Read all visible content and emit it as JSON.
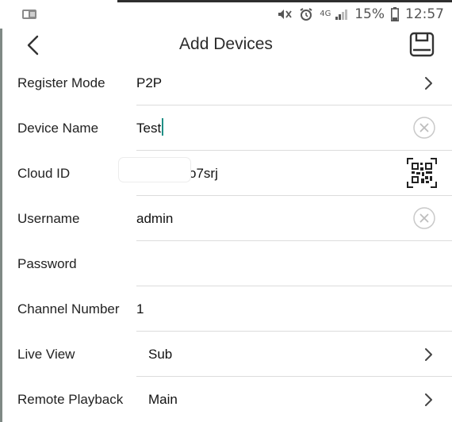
{
  "status_bar": {
    "battery": "15%",
    "time": "12:57",
    "network": "4G"
  },
  "header": {
    "title": "Add Devices"
  },
  "form": {
    "register_mode": {
      "label": "Register Mode",
      "value": "P2P"
    },
    "device_name": {
      "label": "Device Name",
      "value": "Test"
    },
    "cloud_id": {
      "label": "Cloud ID",
      "value": "o7srj"
    },
    "username": {
      "label": "Username",
      "value": "admin"
    },
    "password": {
      "label": "Password",
      "value": ""
    },
    "channel_number": {
      "label": "Channel Number",
      "value": "1"
    },
    "live_view": {
      "label": "Live View",
      "value": "Sub"
    },
    "remote_playback": {
      "label": "Remote Playback",
      "value": "Main"
    }
  },
  "icons": {
    "back": "chevron-left-icon",
    "save": "save-icon",
    "qr": "qr-code-icon",
    "clear": "clear-icon",
    "chevron": "chevron-right-icon"
  },
  "colors": {
    "accent_cursor": "#1f8f86",
    "divider": "#dcdcdc"
  }
}
